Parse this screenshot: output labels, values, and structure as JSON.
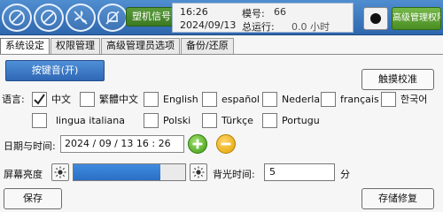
{
  "header": {
    "signal_label": "塑机信号",
    "time": "16:26",
    "date": "2024/09/13",
    "model_label": "模号:",
    "model_value": "66",
    "run_label": "总运行:",
    "run_value": "0.0 小时",
    "advanced_button": "高级管理权限",
    "icons": [
      "no-signal-icon",
      "no-signal-icon",
      "fan-off-icon",
      "alarm-off-icon"
    ],
    "record_icon": "record-icon"
  },
  "tabs": [
    "系统设定",
    "权限管理",
    "高级管理员选项",
    "备份/还原"
  ],
  "active_tab": 0,
  "buttons": {
    "key_sound": "按键音(开)",
    "touch_calibration": "触摸校准",
    "save": "保存",
    "storage_repair": "存储修复"
  },
  "language": {
    "label": "语言:",
    "options": [
      {
        "label": "中文",
        "checked": true
      },
      {
        "label": "繁體中文",
        "checked": false
      },
      {
        "label": "English",
        "checked": false
      },
      {
        "label": "español",
        "checked": false
      },
      {
        "label": "Nederla",
        "checked": false
      },
      {
        "label": "français",
        "checked": false
      },
      {
        "label": "한국어",
        "checked": false
      },
      {
        "label": "lingua italiana",
        "checked": false
      },
      {
        "label": "Polski",
        "checked": false
      },
      {
        "label": "Türkçe",
        "checked": false
      },
      {
        "label": "Portugu",
        "checked": false
      }
    ]
  },
  "datetime": {
    "label": "日期与时间:",
    "value": "2024 / 09 /  13    16 : 26"
  },
  "brightness": {
    "label": "屏幕亮度",
    "level": 0.78
  },
  "backlight": {
    "label": "背光时间:",
    "value": "5",
    "unit": "分"
  },
  "colors": {
    "topbar": "#2e67ad",
    "accent_blue": "#2f67b5",
    "green": "#3f9a14",
    "yellow": "#e2a200"
  }
}
